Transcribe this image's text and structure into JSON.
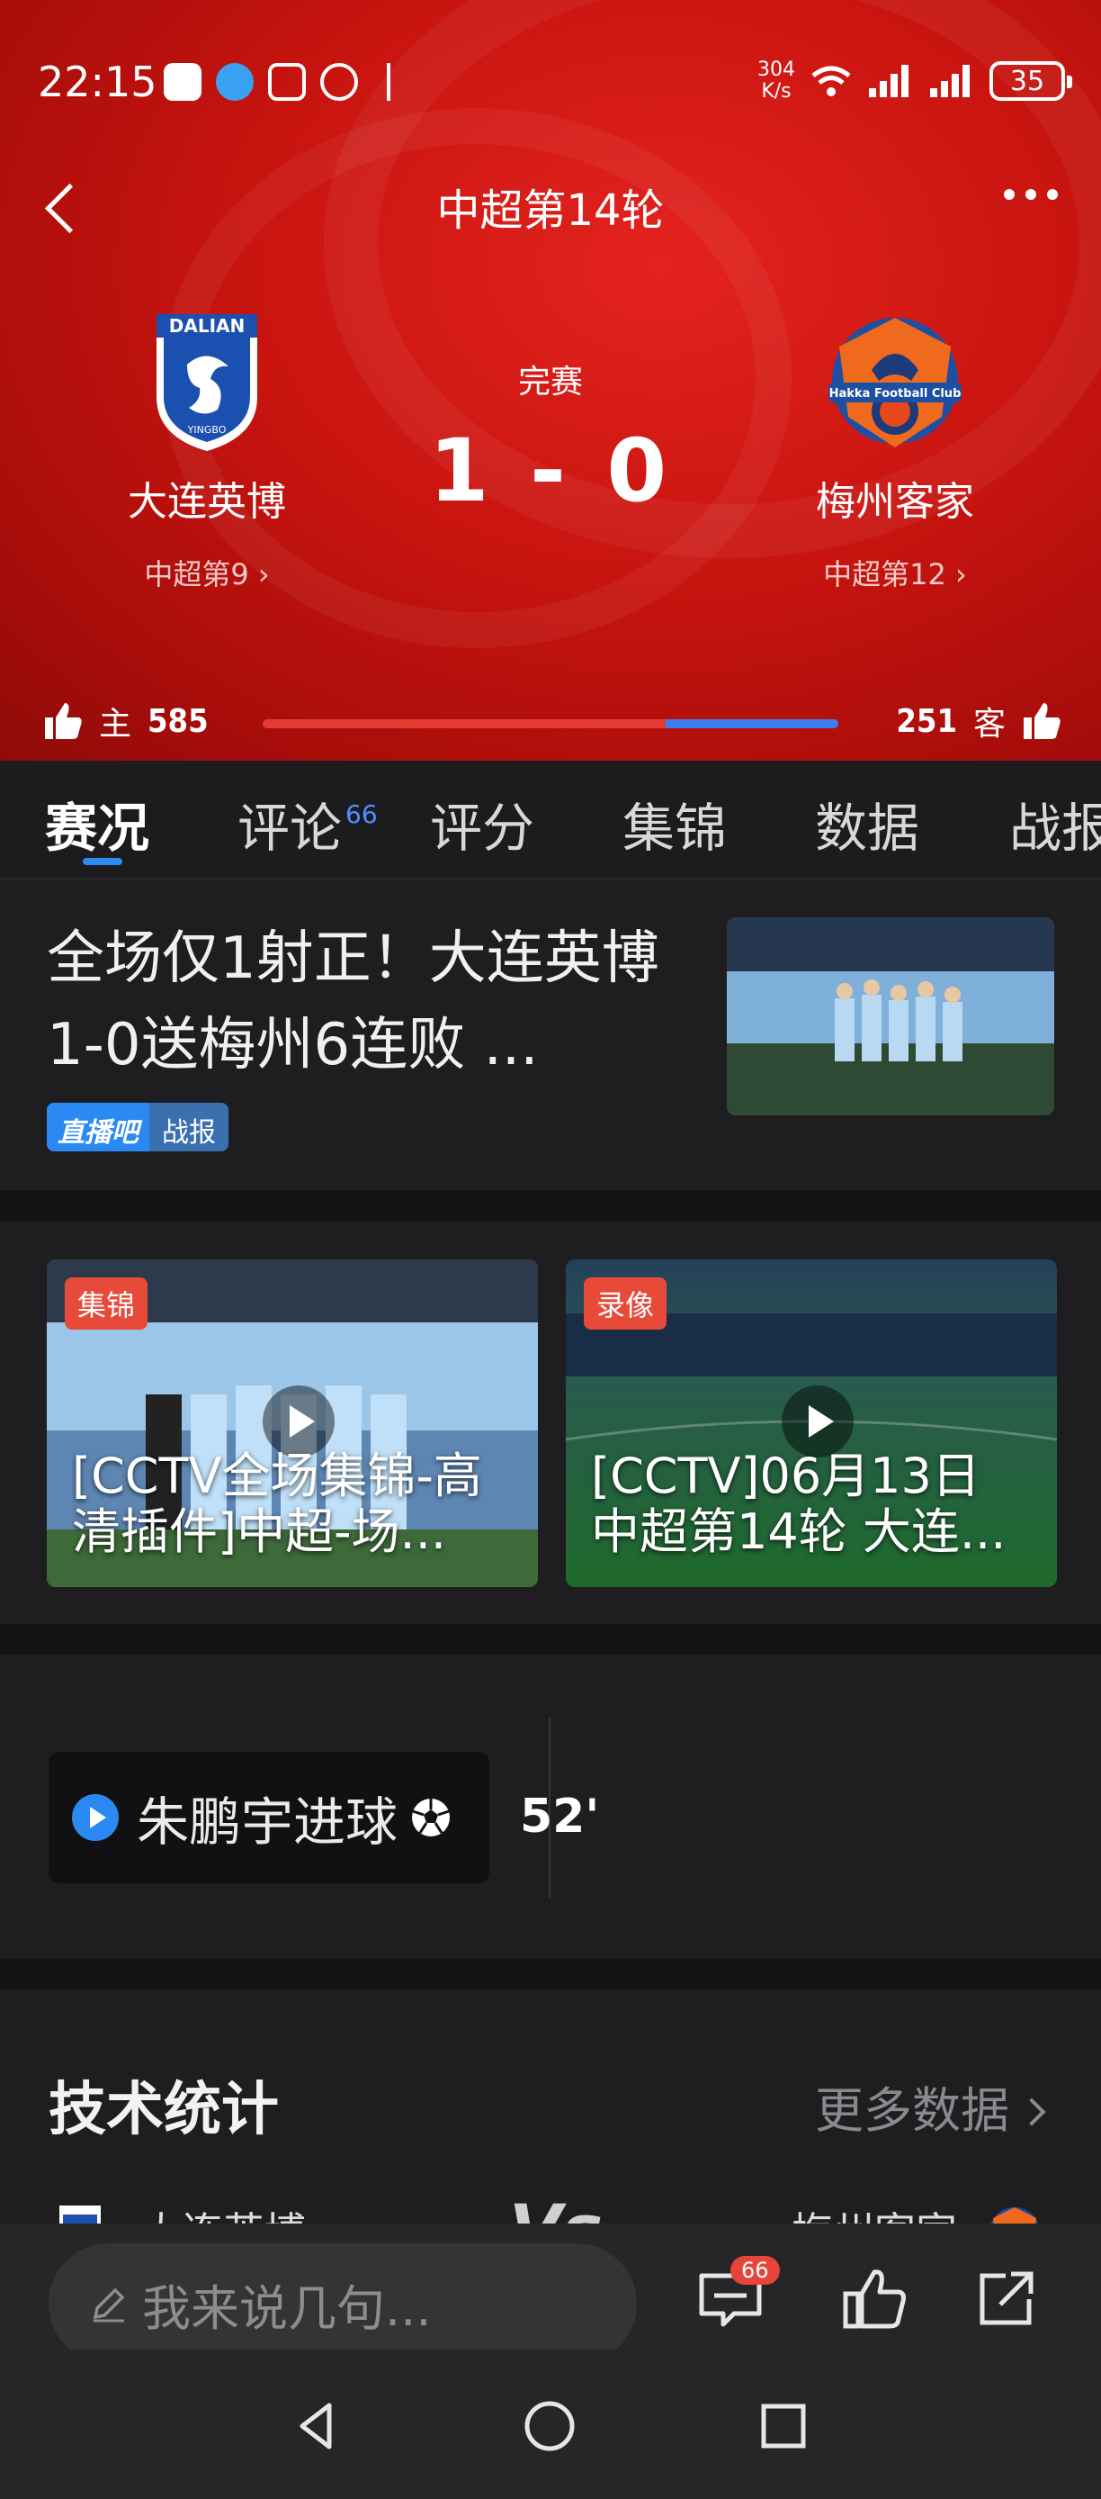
{
  "status_bar": {
    "time": "22:15",
    "net_speed_value": "304",
    "net_speed_unit": "K/s",
    "battery": "35",
    "icons": [
      "app-icon",
      "app-icon",
      "nfc-icon",
      "alarm-icon",
      "bluetooth-icon",
      "wifi-icon",
      "signal-icon",
      "signal-icon"
    ]
  },
  "header": {
    "title": "中超第14轮",
    "back_icon": "back-arrow-icon",
    "more_icon": "more-dots-icon"
  },
  "match": {
    "status": "完赛",
    "score": "1 - 0",
    "home": {
      "name": "大连英博",
      "rank": "中超第9",
      "crest_text": "DALIAN",
      "crest_sub": "YINGBO",
      "color": "#1b4fb0"
    },
    "away": {
      "name": "梅州客家",
      "rank": "中超第12",
      "crest_text": "Hakka Football Club",
      "color": "#1d4fa3",
      "accent": "#f06a1e"
    }
  },
  "likes": {
    "home_label": "主",
    "home_count": "585",
    "away_label": "客",
    "away_count": "251",
    "home_color": "#e43b35",
    "away_color": "#3d7df2",
    "away_share": 0.3
  },
  "tabs": [
    {
      "label": "赛况",
      "active": true
    },
    {
      "label": "评论",
      "badge": "66"
    },
    {
      "label": "评分"
    },
    {
      "label": "集锦"
    },
    {
      "label": "数据"
    },
    {
      "label": "战报"
    }
  ],
  "news": {
    "headline": "全场仅1射正！大连英博1-0送梅州6连败 ...",
    "source": "直播吧",
    "kind": "战报"
  },
  "videos": [
    {
      "badge": "集锦",
      "title": "[CCTV全场集锦-高清插件]中超-场..."
    },
    {
      "badge": "录像",
      "title": "[CCTV]06月13日 中超第14轮 大连..."
    }
  ],
  "events": [
    {
      "text": "朱鹏宇进球",
      "minute": "52'"
    }
  ],
  "tech_stats": {
    "title": "技术统计",
    "more": "更多数据",
    "home": "大连英博",
    "away": "梅州客家",
    "vs": "Vs"
  },
  "bottom": {
    "placeholder": "我来说几句...",
    "comment_count": "66"
  }
}
